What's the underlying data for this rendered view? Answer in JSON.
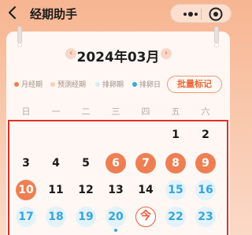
{
  "header": {
    "title": "经期助手"
  },
  "calendar": {
    "month_title": "2024年03月",
    "prev_icon": "‹",
    "next_icon": "›",
    "legend": [
      {
        "label": "月经期",
        "color": "#ee7f52"
      },
      {
        "label": "预测经期",
        "color": "#f9cdb8"
      },
      {
        "label": "排卵期",
        "color": "#d4ecf8"
      },
      {
        "label": "排卵日",
        "color": "#36a6dc"
      }
    ],
    "batch_button": "批量标记",
    "weekdays": [
      "日",
      "一",
      "二",
      "三",
      "四",
      "五",
      "六"
    ],
    "days": [
      {
        "d": "1",
        "col": 5,
        "row": 0,
        "type": "normal"
      },
      {
        "d": "2",
        "col": 6,
        "row": 0,
        "type": "normal"
      },
      {
        "d": "3",
        "col": 0,
        "row": 1,
        "type": "normal"
      },
      {
        "d": "4",
        "col": 1,
        "row": 1,
        "type": "normal"
      },
      {
        "d": "5",
        "col": 2,
        "row": 1,
        "type": "normal"
      },
      {
        "d": "6",
        "col": 3,
        "row": 1,
        "type": "period"
      },
      {
        "d": "7",
        "col": 4,
        "row": 1,
        "type": "period"
      },
      {
        "d": "8",
        "col": 5,
        "row": 1,
        "type": "period"
      },
      {
        "d": "9",
        "col": 6,
        "row": 1,
        "type": "period"
      },
      {
        "d": "10",
        "col": 0,
        "row": 2,
        "type": "period"
      },
      {
        "d": "11",
        "col": 1,
        "row": 2,
        "type": "normal"
      },
      {
        "d": "12",
        "col": 2,
        "row": 2,
        "type": "normal"
      },
      {
        "d": "13",
        "col": 3,
        "row": 2,
        "type": "normal"
      },
      {
        "d": "14",
        "col": 4,
        "row": 2,
        "type": "normal"
      },
      {
        "d": "15",
        "col": 5,
        "row": 2,
        "type": "fertile"
      },
      {
        "d": "16",
        "col": 6,
        "row": 2,
        "type": "fertile"
      },
      {
        "d": "17",
        "col": 0,
        "row": 3,
        "type": "fertile"
      },
      {
        "d": "18",
        "col": 1,
        "row": 3,
        "type": "fertile"
      },
      {
        "d": "19",
        "col": 2,
        "row": 3,
        "type": "fertile"
      },
      {
        "d": "20",
        "col": 3,
        "row": 3,
        "type": "ovulation"
      },
      {
        "d": "今",
        "col": 4,
        "row": 3,
        "type": "today"
      },
      {
        "d": "22",
        "col": 5,
        "row": 3,
        "type": "fertile"
      },
      {
        "d": "23",
        "col": 6,
        "row": 3,
        "type": "fertile"
      }
    ]
  }
}
